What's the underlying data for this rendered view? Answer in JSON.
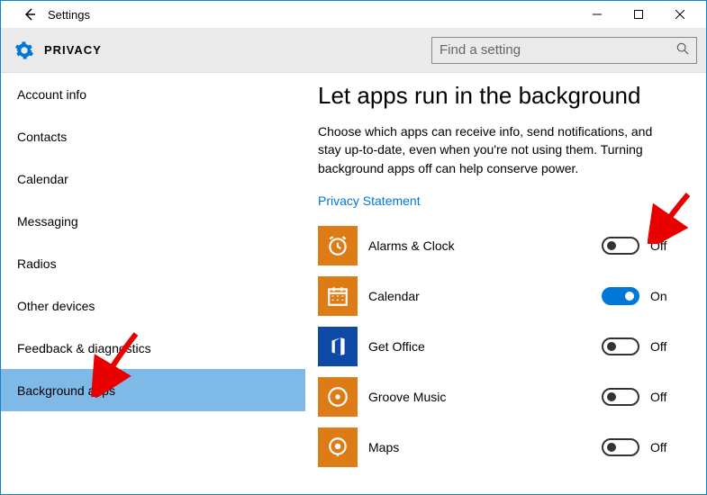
{
  "titlebar": {
    "title": "Settings"
  },
  "header": {
    "brand": "PRIVACY",
    "search_placeholder": "Find a setting"
  },
  "sidebar": {
    "items": [
      {
        "label": "Account info"
      },
      {
        "label": "Contacts"
      },
      {
        "label": "Calendar"
      },
      {
        "label": "Messaging"
      },
      {
        "label": "Radios"
      },
      {
        "label": "Other devices"
      },
      {
        "label": "Feedback & diagnostics"
      },
      {
        "label": "Background apps"
      }
    ],
    "selected_index": 7
  },
  "content": {
    "heading": "Let apps run in the background",
    "description": "Choose which apps can receive info, send notifications, and stay up-to-date, even when you're not using them. Turning background apps off can help conserve power.",
    "privacy_link": "Privacy Statement",
    "toggle_labels": {
      "on": "On",
      "off": "Off"
    },
    "apps": [
      {
        "name": "Alarms & Clock",
        "icon": "alarm-icon",
        "bg": "orange",
        "on": false
      },
      {
        "name": "Calendar",
        "icon": "calendar-icon",
        "bg": "orange",
        "on": true
      },
      {
        "name": "Get Office",
        "icon": "office-icon",
        "bg": "blue",
        "on": false
      },
      {
        "name": "Groove Music",
        "icon": "music-icon",
        "bg": "orange",
        "on": false
      },
      {
        "name": "Maps",
        "icon": "maps-icon",
        "bg": "orange",
        "on": false
      }
    ]
  }
}
